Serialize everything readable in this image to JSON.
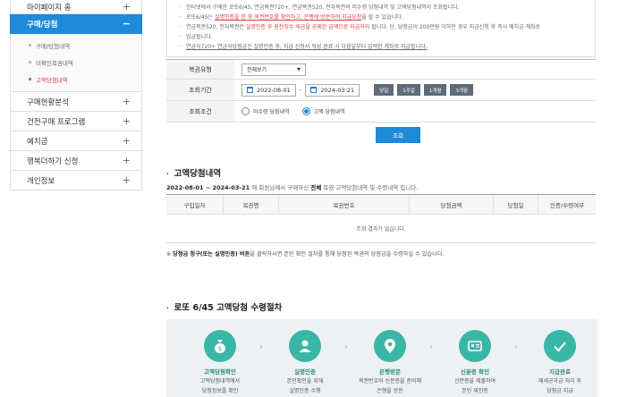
{
  "sidebar": {
    "items": [
      {
        "label": "마이페이지 홈",
        "sign": "+"
      },
      {
        "label": "구매/당첨",
        "sign": "−"
      },
      {
        "label": "구매현황분석",
        "sign": "+"
      },
      {
        "label": "건전구매 프로그램",
        "sign": "+"
      },
      {
        "label": "예치금",
        "sign": "+"
      },
      {
        "label": "행복더하기 신청",
        "sign": "+"
      },
      {
        "label": "개인정보",
        "sign": "+"
      }
    ],
    "sub_items": [
      "구매/당첨내역",
      "미확인복권내역",
      "고액당첨내역"
    ]
  },
  "notice": {
    "lines": [
      {
        "pre": "인터넷에서 구매한 로또6/45, 연금복권720+, 연금복권520, 전자복권의 미수령 당첨내역 및 고액당첨내역이 조회됩니다.",
        "red": "",
        "post": ""
      },
      {
        "pre": "로또6/45는 ",
        "red": "실명인증을 한 후 복권번호를 확인하고, 은행에 방문하여 지급요청",
        "post": "을 할 수 있습니다."
      },
      {
        "pre": "연금복권520, 전자복권은 ",
        "red": "실명인증 후 원천징수 세금을 공제한 금액으로 지급처리",
        "post": " 됩니다. 단, 당첨금이 200만원 이하인 경우 지급신청 후 즉시 예치금 계좌로"
      },
      {
        "pre": "입금됩니다.",
        "red": "",
        "post": ""
      },
      {
        "pre": "연금식720+ 연금식당첨금은 실명인증 후, 지급 신청서 작성 완료 시 다음달부터 입력한 계좌로 지급됩니다.",
        "red": "",
        "post": ""
      }
    ]
  },
  "form": {
    "type_label": "복권유형",
    "type_value": "전체보기",
    "period_label": "조회기간",
    "date_from": "2022-08-01",
    "date_to": "2024-03-21",
    "period_buttons": [
      "당일",
      "1주일",
      "1개월",
      "3개월"
    ],
    "cond_label": "조회조건",
    "radio_unclaimed": "미수령 당첨내역",
    "radio_high": "고액 당첨내역",
    "submit": "조회"
  },
  "result": {
    "title": "고액당첨내역",
    "period_range": "2022-08-01 ~ 2024-03-21",
    "period_mid": " 에 회원님께서 구매하신 ",
    "period_bold": "전체",
    "period_tail": " 복권 고액당첨내역 및 수령내역 입니다.",
    "columns": [
      "구입일자",
      "복권명",
      "복권번호",
      "당첨금액",
      "당첨일",
      "인증/수령여부"
    ],
    "empty": "조회 결과가 없습니다.",
    "footnote_pre": "※ ",
    "footnote_bold": "당첨금 청구(또는 실명인증) 버튼",
    "footnote_post": "을 클릭하시면 본인 확인 절차를 통해 당첨된 복권의 당첨금을 수령하실 수 있습니다."
  },
  "procedure": {
    "title": "로또 6/45 고액당첨 수령절차",
    "steps": [
      {
        "title": "고액당첨확인",
        "desc1": "고액당첨내역에서",
        "desc2": "당첨정보를 확인"
      },
      {
        "title": "실명인증",
        "desc1": "본인확인을 위해",
        "desc2": "실명인증 수행"
      },
      {
        "title": "은행방문",
        "desc1": "복권번호와 신분증을 준비해",
        "desc2": "은행을 방문"
      },
      {
        "title": "신분증 확인",
        "desc1": "신분증을 제출하여",
        "desc2": "본인 재인증"
      },
      {
        "title": "지급완료",
        "desc1": "제세공과금 처리 후",
        "desc2": "당첨금 지급"
      }
    ]
  },
  "colors": {
    "accent": "#1f8ad9",
    "teal": "#39b7a6",
    "alert": "#e23c3c"
  }
}
